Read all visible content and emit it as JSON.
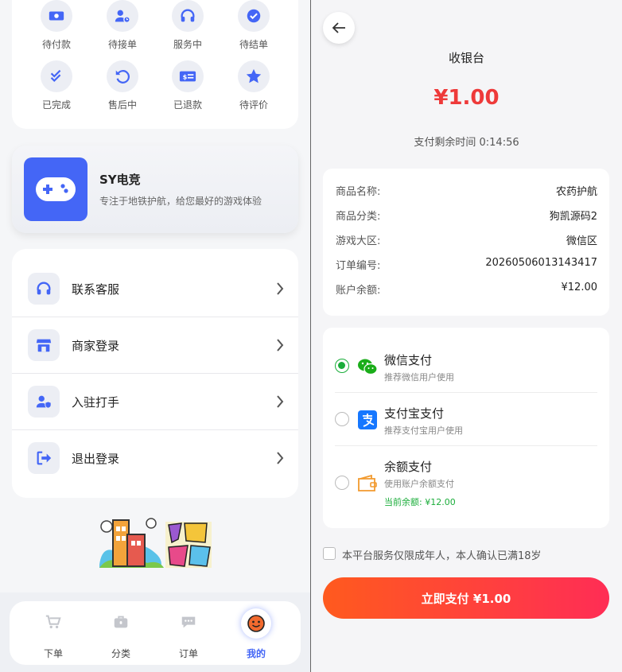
{
  "left": {
    "order_status": [
      {
        "label": "待付款",
        "icon": "money-icon"
      },
      {
        "label": "待接单",
        "icon": "user-clock-icon"
      },
      {
        "label": "服务中",
        "icon": "headset-icon"
      },
      {
        "label": "待结单",
        "icon": "check-circle-icon"
      },
      {
        "label": "已完成",
        "icon": "double-check-icon"
      },
      {
        "label": "售后中",
        "icon": "rotate-left-icon"
      },
      {
        "label": "已退款",
        "icon": "refund-bill-icon"
      },
      {
        "label": "待评价",
        "icon": "star-icon"
      }
    ],
    "promo": {
      "title": "SY电竞",
      "subtitle": "专注于地铁护航，给您最好的游戏体验",
      "icon": "gamepad-icon"
    },
    "menu": [
      {
        "label": "联系客服",
        "icon": "headset-icon"
      },
      {
        "label": "商家登录",
        "icon": "store-icon"
      },
      {
        "label": "入驻打手",
        "icon": "user-shield-icon"
      },
      {
        "label": "退出登录",
        "icon": "logout-icon"
      }
    ],
    "tabs": [
      {
        "label": "下单",
        "icon": "cart-icon"
      },
      {
        "label": "分类",
        "icon": "briefcase-icon"
      },
      {
        "label": "订单",
        "icon": "chat-icon"
      },
      {
        "label": "我的",
        "icon": "smiley-avatar-icon",
        "active": true
      }
    ],
    "accent": "#4466f6"
  },
  "right": {
    "title": "收银台",
    "amount": "¥1.00",
    "timer": "支付剩余时间 0:14:56",
    "info": [
      {
        "key": "商品名称:",
        "value": "农药护航"
      },
      {
        "key": "商品分类:",
        "value": "狗凯源码2"
      },
      {
        "key": "游戏大区:",
        "value": "微信区"
      },
      {
        "key": "订单编号:",
        "value": "20260506013143417"
      },
      {
        "key": "账户余额:",
        "value": "¥12.00"
      }
    ],
    "payment_methods": [
      {
        "name": "微信支付",
        "desc": "推荐微信用户使用",
        "icon": "wechat-icon",
        "selected": true
      },
      {
        "name": "支付宝支付",
        "desc": "推荐支付宝用户使用",
        "icon": "alipay-icon",
        "selected": false
      },
      {
        "name": "余额支付",
        "desc": "使用账户余额支付",
        "icon": "wallet-icon",
        "selected": false,
        "balance": "当前余额: ¥12.00"
      }
    ],
    "agreement": "本平台服务仅限成年人，本人确认已满18岁",
    "pay_button": "立即支付 ¥1.00",
    "colors": {
      "amount": "#ee3a3a",
      "selected": "#1aad3a",
      "button_start": "#ff5a1e",
      "button_end": "#ff2d55"
    }
  }
}
